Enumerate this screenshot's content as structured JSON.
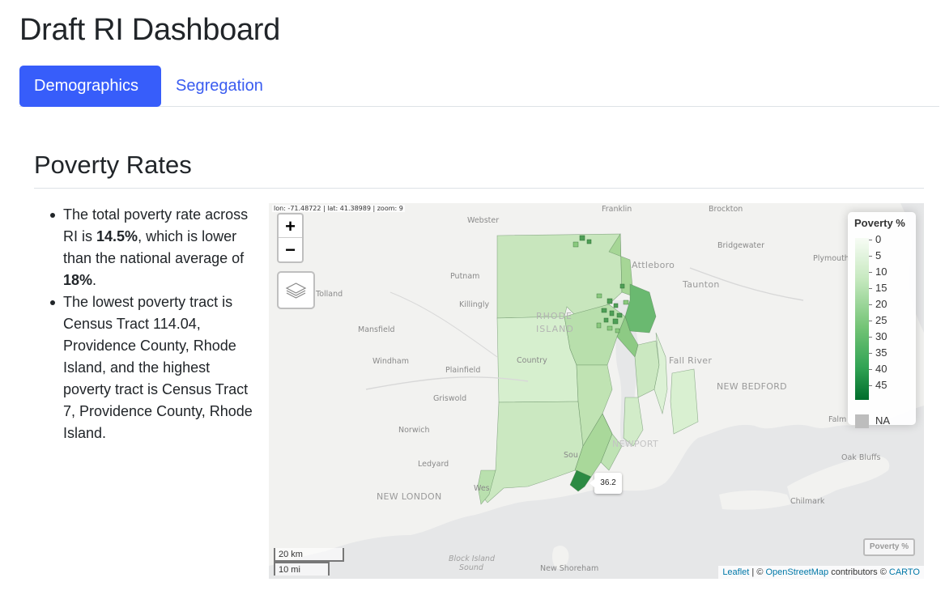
{
  "app": {
    "title": "Draft RI Dashboard"
  },
  "tabs": [
    {
      "label": "Demographics",
      "active": true
    },
    {
      "label": "Segregation",
      "active": false
    }
  ],
  "section": {
    "title": "Poverty Rates"
  },
  "bullets": {
    "b1_pre": "The total poverty rate across RI is ",
    "b1_rate": "14.5%",
    "b1_mid": ", which is lower than the national average of ",
    "b1_nat": "18%",
    "b1_end": ".",
    "b2": "The lowest poverty tract is Census Tract 114.04, Providence County, Rhode Island, and the highest poverty tract is Census Tract 7, Providence County, Rhode Island."
  },
  "map": {
    "coord_readout": "lon: -71.48722 | lat: 41.38989 | zoom: 9",
    "zoom_in": "+",
    "zoom_out": "−",
    "legend": {
      "title": "Poverty %",
      "ticks": [
        "0",
        "5",
        "10",
        "15",
        "20",
        "25",
        "30",
        "35",
        "40",
        "45"
      ],
      "na_label": "NA",
      "colors": {
        "low": "#f7fcf5",
        "high": "#006d2c",
        "na": "#bdbdbd"
      }
    },
    "layer_chip": "Poverty %",
    "scale_km": "20 km",
    "scale_mi": "10 mi",
    "tooltip": "36.2",
    "attribution": {
      "leaflet": "Leaflet",
      "sep": " | © ",
      "osm": "OpenStreetMap",
      "mid": " contributors © ",
      "carto": "CARTO"
    },
    "places": {
      "franklin": "Franklin",
      "brockton": "Brockton",
      "webster": "Webster",
      "bridgewater": "Bridgewater",
      "plymouth": "Plymouth",
      "attleboro": "Attleboro",
      "putnam": "Putnam",
      "taunton": "Taunton",
      "tolland": "Tolland",
      "killingly": "Killingly",
      "rhode": "RHODE",
      "island": "ISLAND",
      "mansfield": "Mansfield",
      "country": "Country",
      "windham": "Windham",
      "fall_river": "Fall River",
      "plainfield": "Plainfield",
      "new_bedford": "NEW BEDFORD",
      "griswold": "Griswold",
      "falmouth": "Falm",
      "newport": "NEWPORT",
      "norwich": "Norwich",
      "ledyard": "Ledyard",
      "oak_bluffs": "Oak Bluffs",
      "south": "Sou",
      "westerly": "Wes",
      "new_london": "NEW LONDON",
      "chilmark": "Chilmark",
      "block_island": "Block Island",
      "sound": "Sound",
      "new_shoreham": "New Shoreham"
    }
  }
}
